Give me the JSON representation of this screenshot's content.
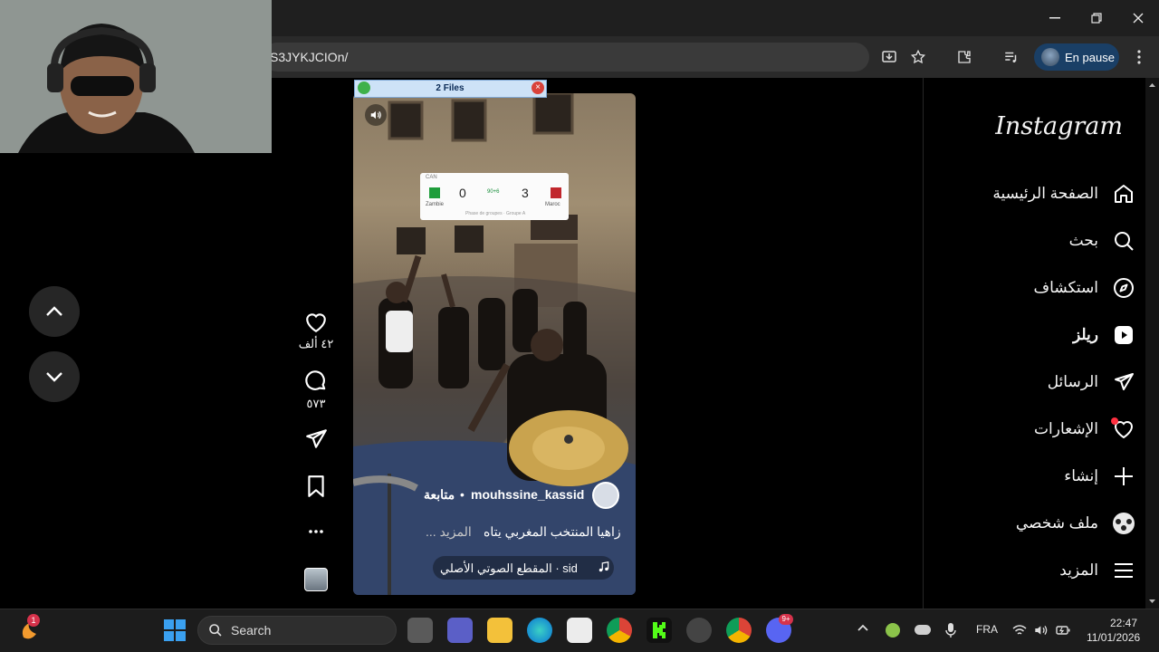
{
  "browser": {
    "url_partial": "S3JYKJCIOn/",
    "profile_label": "En pause"
  },
  "files_dialog": {
    "title": "2 Files"
  },
  "scoreboard": {
    "competition": "CAN",
    "team_left": "Zambie",
    "score_left": "0",
    "status": "90+6",
    "score_right": "3",
    "team_right": "Maroc",
    "footer": "Phase de groupes · Groupe A"
  },
  "reel": {
    "username": "mouhssine_kassid",
    "separator": "•",
    "follow_label": "متابعة",
    "caption": "زاهيا المنتخب المغربي يتاه",
    "more_label": "... المزيد",
    "audio": "المقطع الصوتي الأصلي · sid"
  },
  "actions": {
    "likes": "٤٢ ألف",
    "comments": "٥٧٣"
  },
  "sidebar": {
    "logo": "Instagram",
    "items": [
      {
        "label": "الصفحة الرئيسية",
        "icon": "home-icon"
      },
      {
        "label": "بحث",
        "icon": "search-icon"
      },
      {
        "label": "استكشاف",
        "icon": "compass-icon"
      },
      {
        "label": "ريلز",
        "icon": "reels-icon"
      },
      {
        "label": "الرسائل",
        "icon": "send-icon"
      },
      {
        "label": "الإشعارات",
        "icon": "heart-icon"
      },
      {
        "label": "إنشاء",
        "icon": "plus-icon"
      },
      {
        "label": "ملف شخصي",
        "icon": "profile-icon"
      },
      {
        "label": "المزيد",
        "icon": "menu-icon"
      }
    ]
  },
  "taskbar": {
    "search_label": "Search",
    "notification_badge": "1",
    "discord_badge": "9+",
    "language": "FRA",
    "time": "22:47",
    "date": "11/01/2026"
  }
}
